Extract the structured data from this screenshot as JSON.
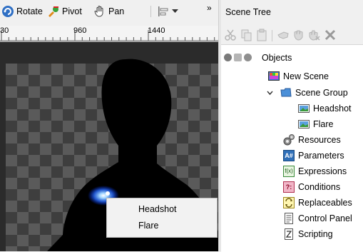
{
  "toolbar": {
    "rotate_label": "Rotate",
    "pivot_label": "Pivot",
    "pan_label": "Pan",
    "overflow": "»"
  },
  "ruler": {
    "marks": [
      "30",
      "960",
      "1440"
    ]
  },
  "context_menu": {
    "items": [
      "Headshot",
      "Flare"
    ]
  },
  "panel": {
    "title": "Scene Tree"
  },
  "tree": {
    "root_label": "Objects",
    "items": [
      {
        "label": "New Scene",
        "icon": "scene-icon"
      },
      {
        "label": "Scene Group",
        "icon": "folder-icon"
      },
      {
        "label": "Headshot",
        "icon": "image-layer-icon"
      },
      {
        "label": "Flare",
        "icon": "image-layer-icon"
      },
      {
        "label": "Resources",
        "icon": "resources-icon"
      },
      {
        "label": "Parameters",
        "icon": "parameters-icon"
      },
      {
        "label": "Expressions",
        "icon": "expressions-icon"
      },
      {
        "label": "Conditions",
        "icon": "conditions-icon"
      },
      {
        "label": "Replaceables",
        "icon": "replaceables-icon"
      },
      {
        "label": "Control Panel",
        "icon": "control-panel-icon"
      },
      {
        "label": "Scripting",
        "icon": "scripting-icon"
      }
    ],
    "icon_text": {
      "parameters": "A#",
      "expressions": "f(x)",
      "conditions": "?:"
    }
  }
}
